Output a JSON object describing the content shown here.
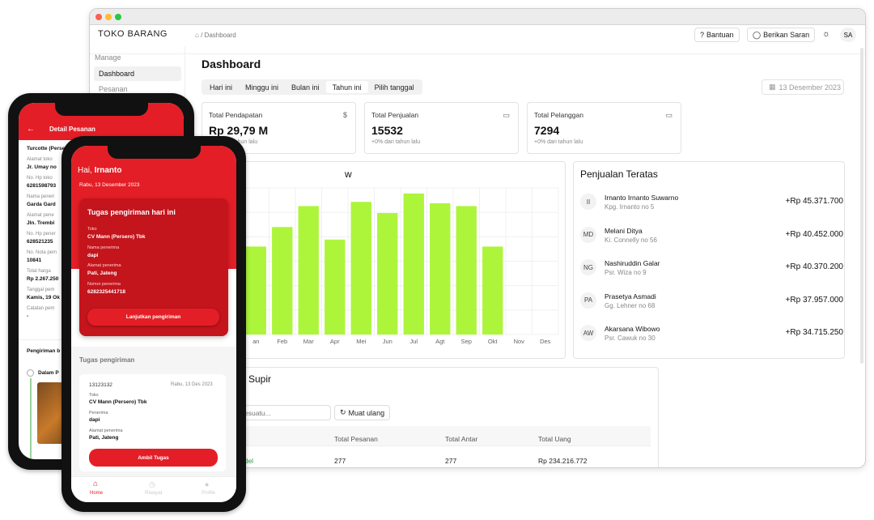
{
  "web": {
    "brand": "TOKO BARANG",
    "breadcrumb": {
      "sep": "/",
      "current": "Dashboard"
    },
    "topbar": {
      "help": "Bantuan",
      "feedback": "Berikan Saran",
      "avatar": "SA"
    },
    "sidebar": {
      "header": "Manage",
      "items": [
        {
          "label": "Dashboard"
        },
        {
          "label": "Pesanan"
        }
      ]
    },
    "title": "Dashboard",
    "tabs": [
      {
        "label": "Hari ini"
      },
      {
        "label": "Minggu ini"
      },
      {
        "label": "Bulan ini"
      },
      {
        "label": "Tahun ini"
      },
      {
        "label": "Pilih tanggal"
      }
    ],
    "active_tab": "Tahun ini",
    "date": "13 Desember 2023",
    "stats": [
      {
        "label": "Total Pendapatan",
        "value": "Rp 29,79 M",
        "sub": "+0% dari tahun lalu",
        "icon": "dollar-icon"
      },
      {
        "label": "Total Penjualan",
        "value": "15532",
        "sub": "+0% dari tahun lalu",
        "icon": "card-icon"
      },
      {
        "label": "Total Pelanggan",
        "value": "7294",
        "sub": "+0% dari tahun lalu",
        "icon": "card-icon"
      }
    ],
    "overview_title": "w",
    "top_sales": {
      "title": "Penjualan Teratas",
      "items": [
        {
          "initials": "II",
          "name": "Irnanto Irnanto Suwarno",
          "address": "Kpg. Irnanto no 5",
          "amount": "+Rp 45.371.700"
        },
        {
          "initials": "MD",
          "name": "Melani Ditya",
          "address": "Ki. Connelly no 56",
          "amount": "+Rp 40.452.000"
        },
        {
          "initials": "NG",
          "name": "Nashiruddin Galar",
          "address": "Psr. Wiza no 9",
          "amount": "+Rp 40.370.200"
        },
        {
          "initials": "PA",
          "name": "Prasetya Asmadi",
          "address": "Gg. Lehner no 68",
          "amount": "+Rp 37.957.000"
        },
        {
          "initials": "AW",
          "name": "Akarsana Wibowo",
          "address": "Psr. Cawuk no 30",
          "amount": "+Rp 34.715.250"
        }
      ]
    },
    "drivers": {
      "title": "Supir",
      "search_placeholder": "esuatu...",
      "reload": "Muat ulang",
      "columns": [
        "Total Pesanan",
        "Total Antar",
        "Total Uang"
      ],
      "row": {
        "name": "adel",
        "orders": "277",
        "delivered": "277",
        "money": "Rp 234.216.772"
      }
    }
  },
  "chart_data": {
    "type": "bar",
    "categories": [
      "Jan",
      "Feb",
      "Mar",
      "Apr",
      "Mei",
      "Jun",
      "Jul",
      "Agt",
      "Sep",
      "Okt",
      "Nov",
      "Des"
    ],
    "category_labels_visible": [
      "an",
      "Feb",
      "Mar",
      "Apr",
      "Mei",
      "Jun",
      "Jul",
      "Agt",
      "Sep",
      "Okt",
      "Nov",
      "Des"
    ],
    "values": [
      63,
      77,
      92,
      68,
      95,
      87,
      101,
      94,
      92,
      63,
      0,
      0
    ],
    "ylim": [
      0,
      105
    ],
    "bar_color": "#adf53b",
    "grid": true
  },
  "phone_back": {
    "header": "Detail Pesanan",
    "fields": [
      {
        "label": "",
        "value": "Turcotte (Persero)"
      },
      {
        "label": "Alamat toko",
        "value": "Jr. Umay no"
      },
      {
        "label": "No. Hp toko",
        "value": "6281598793"
      },
      {
        "label": "Nama peneri",
        "value": "Garda Gard"
      },
      {
        "label": "Alamat pene",
        "value": "Jln. Trembi"
      },
      {
        "label": "No. Hp pener",
        "value": "628521235"
      },
      {
        "label": "No. Nota pem",
        "value": "10841"
      },
      {
        "label": "Total harga",
        "value": "Rp 2.267.250"
      },
      {
        "label": "Tanggal pem",
        "value": "Kamis, 19 Ok"
      },
      {
        "label": "Catatan pem",
        "value": "-"
      }
    ],
    "shipping": "Pengiriman b",
    "step": "Dalam P"
  },
  "phone_front": {
    "greeting": "Hai, ",
    "name": "Irnanto",
    "date": "Rabu, 13 Desember 2023",
    "today_title": "Tugas pengiriman hari ini",
    "today": [
      {
        "label": "Toko",
        "value": "CV Mann (Persero) Tbk"
      },
      {
        "label": "Nama penerima",
        "value": "dapi"
      },
      {
        "label": "Alamat penerima",
        "value": "Pati, Jateng"
      },
      {
        "label": "Nomor penerima",
        "value": "6282325441718"
      }
    ],
    "continue_btn": "Lanjutkan pengiriman",
    "tasks_title": "Tugas pengiriman",
    "task": {
      "id": "13123132",
      "date": "Rabu, 13 Des 2023",
      "fields": [
        {
          "label": "Toko",
          "value": "CV Mann (Persero) Tbk"
        },
        {
          "label": "Penerima",
          "value": "dapi"
        },
        {
          "label": "Alamat penerima",
          "value": "Pati, Jateng"
        }
      ],
      "take_btn": "Ambil Tugas"
    },
    "nav": [
      {
        "label": "Home"
      },
      {
        "label": "Riwayat"
      },
      {
        "label": "Profile"
      }
    ]
  },
  "colors": {
    "red": "#e41e26",
    "green": "#adf53b",
    "dark": "#111111"
  }
}
